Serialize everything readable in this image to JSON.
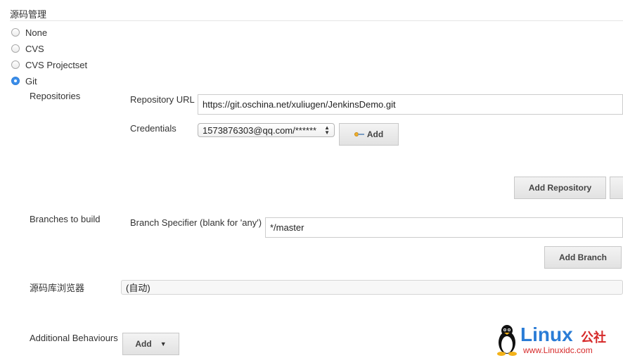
{
  "section": {
    "title": "源码管理"
  },
  "scm_options": [
    {
      "label": "None",
      "selected": false
    },
    {
      "label": "CVS",
      "selected": false
    },
    {
      "label": "CVS Projectset",
      "selected": false
    },
    {
      "label": "Git",
      "selected": true
    }
  ],
  "repositories": {
    "label": "Repositories",
    "url_label": "Repository URL",
    "url_value": "https://git.oschina.net/xuliugen/JenkinsDemo.git",
    "credentials_label": "Credentials",
    "credentials_value": "1573876303@qq.com/******",
    "add_credentials_label": "Add",
    "add_repository_label": "Add Repository"
  },
  "branches": {
    "label": "Branches to build",
    "specifier_label": "Branch Specifier (blank for 'any')",
    "specifier_value": "*/master",
    "add_branch_label": "Add Branch"
  },
  "browser": {
    "label": "源码库浏览器",
    "value": "(自动)"
  },
  "additional": {
    "label": "Additional Behaviours",
    "add_label": "Add"
  },
  "watermark": {
    "brand": "Linux",
    "brand_suffix": "公社",
    "url": "www.Linuxidc.com",
    "brand_color": "#2a7cd6",
    "accent_color": "#d62a2a"
  }
}
